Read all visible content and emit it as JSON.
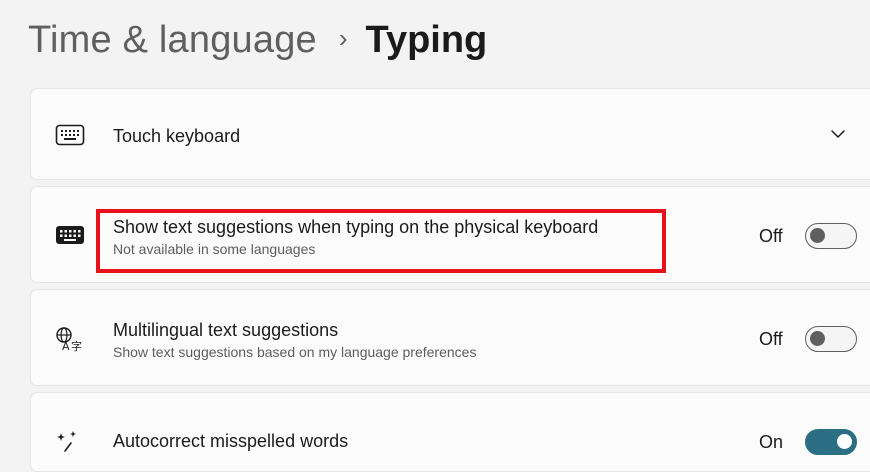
{
  "breadcrumb": {
    "parent": "Time & language",
    "separator": "›",
    "current": "Typing"
  },
  "settings": [
    {
      "title": "Touch keyboard",
      "icon": "touch-keyboard-icon",
      "control": "expand-chevron"
    },
    {
      "title": "Show text suggestions when typing on the physical keyboard",
      "subtitle": "Not available in some languages",
      "icon": "keyboard-icon",
      "toggle_label": "Off",
      "toggle_state": false
    },
    {
      "title": "Multilingual text suggestions",
      "subtitle": "Show text suggestions based on my language preferences",
      "icon": "multilingual-icon",
      "toggle_label": "Off",
      "toggle_state": false
    },
    {
      "title": "Autocorrect misspelled words",
      "icon": "sparkle-icon",
      "toggle_label": "On",
      "toggle_state": true
    }
  ],
  "colors": {
    "accent": "#2c6e84",
    "highlight_border": "#e8101a",
    "page_background": "#f3f3f3",
    "card_background": "#fbfbfb"
  }
}
